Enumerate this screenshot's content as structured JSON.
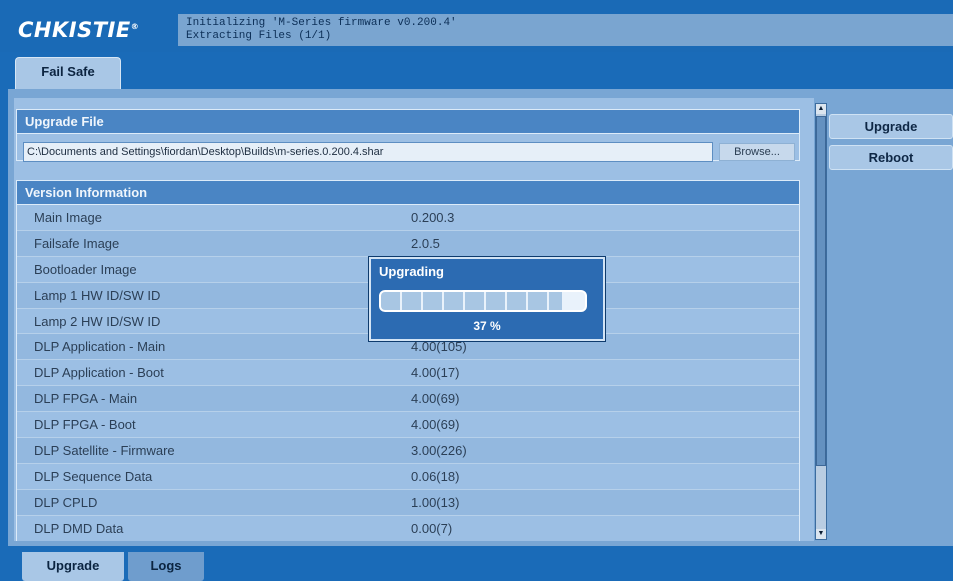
{
  "header": {
    "logo_text": "CHKISTIE",
    "logo_mark": "®",
    "status_lines": [
      "Initializing 'M-Series firmware v0.200.4'",
      "Extracting Files (1/1)"
    ]
  },
  "top_tabs": [
    {
      "label": "Fail Safe",
      "selected": true
    }
  ],
  "upgrade_file": {
    "title": "Upgrade File",
    "path_value": "C:\\Documents and Settings\\fiordan\\Desktop\\Builds\\m-series.0.200.4.shar",
    "browse_label": "Browse..."
  },
  "version_info": {
    "title": "Version Information",
    "rows": [
      {
        "label": "Main Image",
        "value": "0.200.3"
      },
      {
        "label": "Failsafe Image",
        "value": "2.0.5"
      },
      {
        "label": "Bootloader Image",
        "value": ""
      },
      {
        "label": "Lamp 1 HW ID/SW ID",
        "value": ""
      },
      {
        "label": "Lamp 2 HW ID/SW ID",
        "value": ""
      },
      {
        "label": "DLP Application - Main",
        "value": "4.00(105)"
      },
      {
        "label": "DLP Application - Boot",
        "value": "4.00(17)"
      },
      {
        "label": "DLP FPGA - Main",
        "value": "4.00(69)"
      },
      {
        "label": "DLP FPGA - Boot",
        "value": "4.00(69)"
      },
      {
        "label": "DLP Satellite - Firmware",
        "value": "3.00(226)"
      },
      {
        "label": "DLP Sequence Data",
        "value": "0.06(18)"
      },
      {
        "label": "DLP CPLD",
        "value": "1.00(13)"
      },
      {
        "label": "DLP DMD Data",
        "value": "0.00(7)"
      }
    ]
  },
  "side_buttons": {
    "upgrade_label": "Upgrade",
    "reboot_label": "Reboot"
  },
  "modal": {
    "title": "Upgrading",
    "progress_percent": 37,
    "progress_text": "37 %"
  },
  "bottom_tabs": [
    {
      "label": "Upgrade",
      "selected": true
    },
    {
      "label": "Logs",
      "selected": false
    }
  ],
  "colors": {
    "brand_blue": "#1a6bb8",
    "panel_blue": "#9cbfe4",
    "title_blue": "#4a85c4"
  }
}
